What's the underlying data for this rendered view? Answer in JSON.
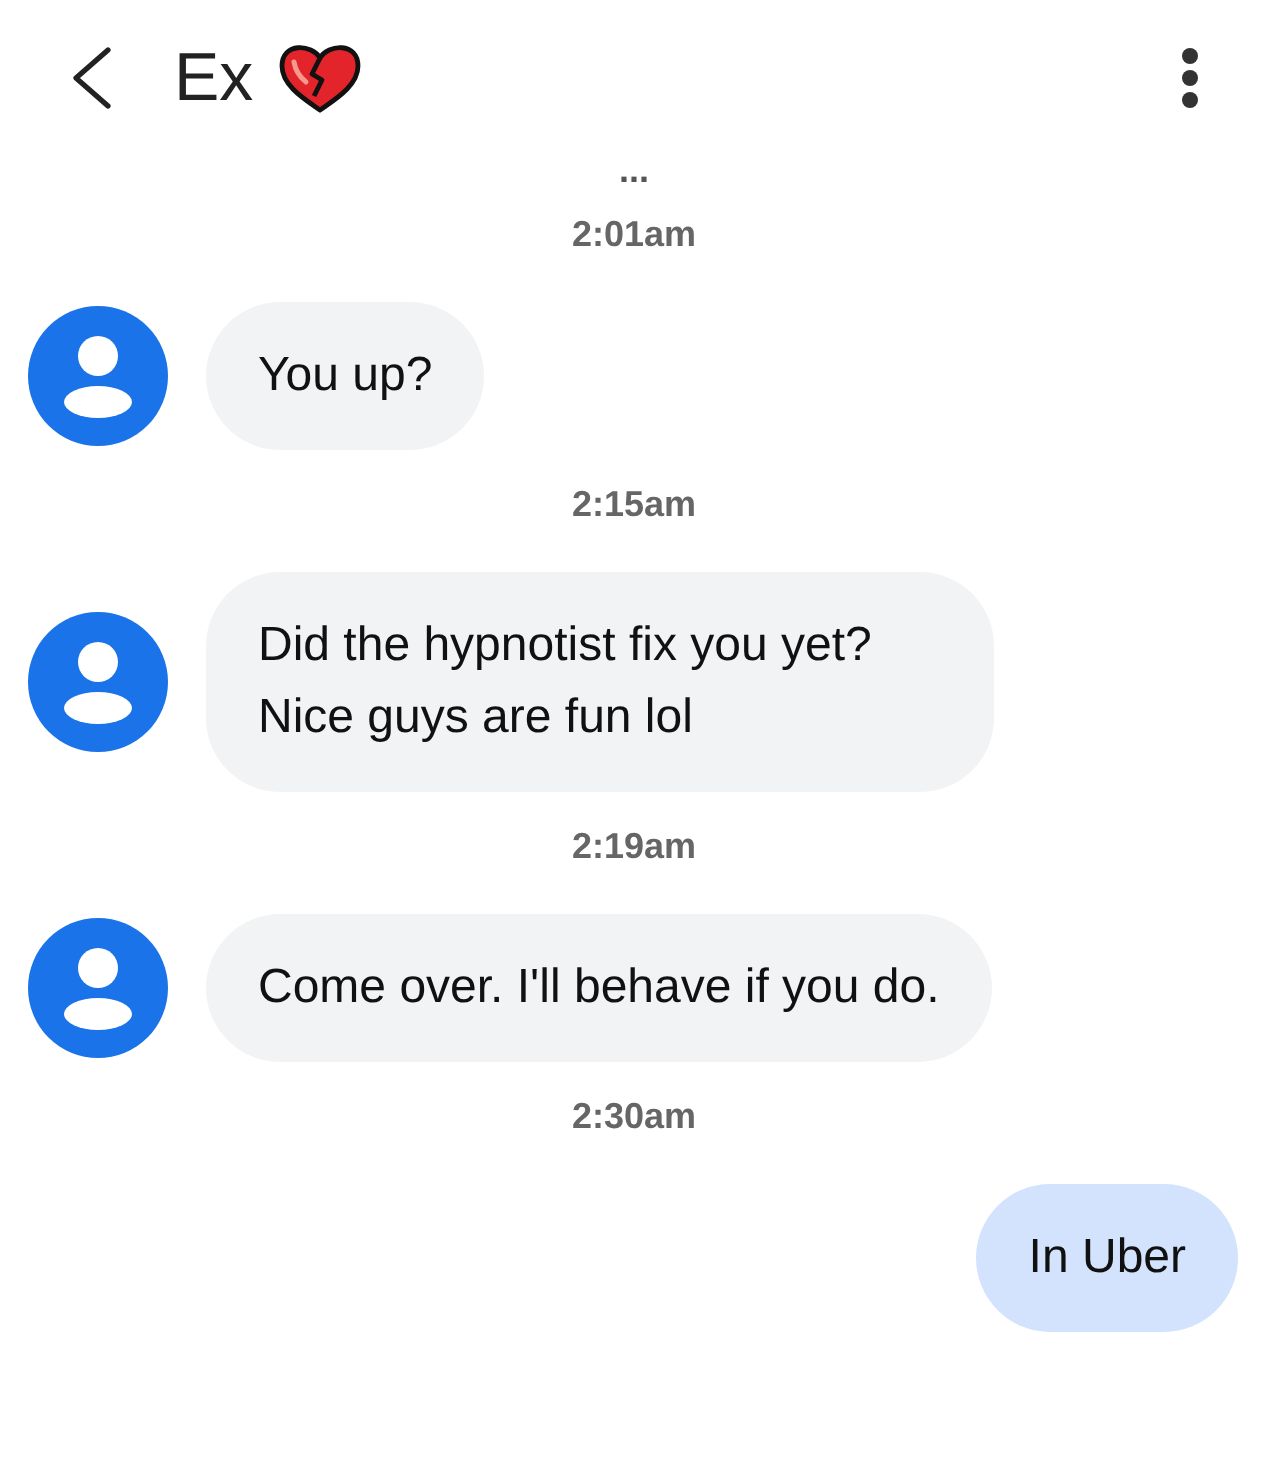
{
  "header": {
    "title": "Ex"
  },
  "typing_indicator": "...",
  "messages": [
    {
      "time": "2:01am",
      "text": "You up?",
      "kind": "incoming"
    },
    {
      "time": "2:15am",
      "text": "Did the hypnotist fix you yet? Nice guys are fun lol",
      "kind": "incoming"
    },
    {
      "time": "2:19am",
      "text": "Come over. I'll behave if you do.",
      "kind": "incoming"
    },
    {
      "time": "2:30am",
      "text": "In Uber",
      "kind": "outgoing"
    }
  ]
}
